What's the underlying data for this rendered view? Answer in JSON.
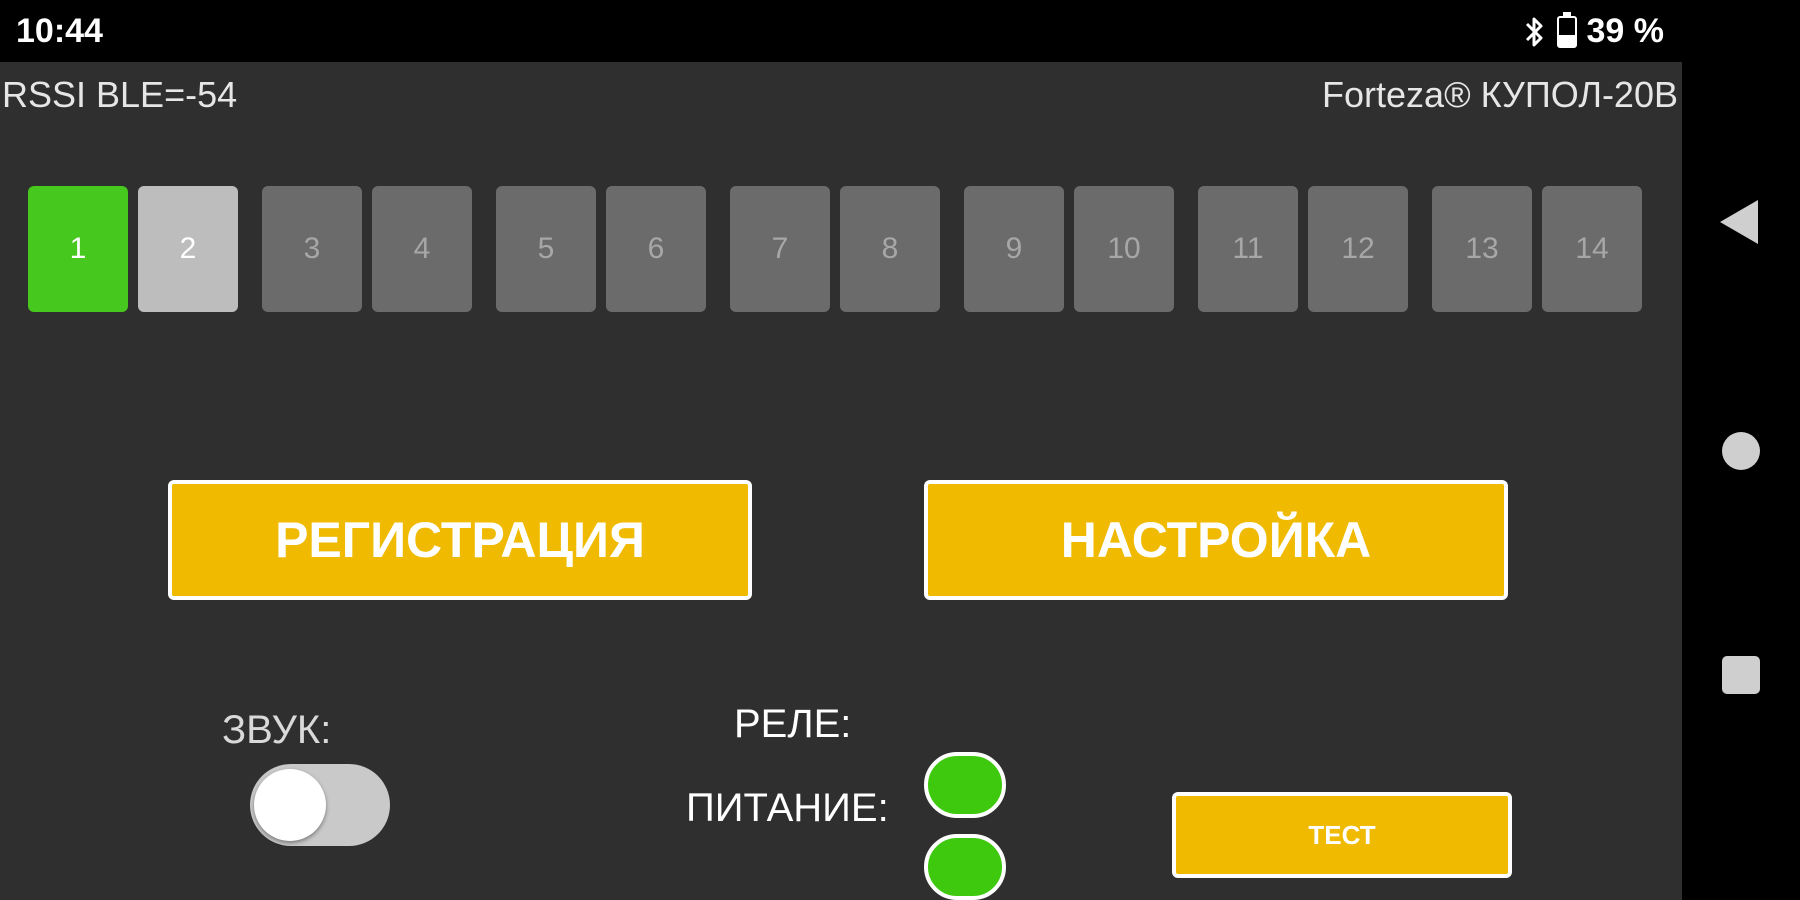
{
  "status_bar": {
    "time": "10:44",
    "battery_percent_text": "39 %",
    "battery_level": 0.39,
    "icons": [
      "bluetooth-icon",
      "battery-icon"
    ]
  },
  "header": {
    "rssi": "RSSI BLE=-54",
    "device_name": "Forteza® КУПОЛ-20B"
  },
  "zones": [
    {
      "label": "1",
      "state": "active"
    },
    {
      "label": "2",
      "state": "selected"
    },
    {
      "label": "3",
      "state": "inactive"
    },
    {
      "label": "4",
      "state": "inactive"
    },
    {
      "label": "5",
      "state": "inactive"
    },
    {
      "label": "6",
      "state": "inactive"
    },
    {
      "label": "7",
      "state": "inactive"
    },
    {
      "label": "8",
      "state": "inactive"
    },
    {
      "label": "9",
      "state": "inactive"
    },
    {
      "label": "10",
      "state": "inactive"
    },
    {
      "label": "11",
      "state": "inactive"
    },
    {
      "label": "12",
      "state": "inactive"
    },
    {
      "label": "13",
      "state": "inactive"
    },
    {
      "label": "14",
      "state": "inactive"
    }
  ],
  "buttons": {
    "registration": "РЕГИСТРАЦИЯ",
    "settings": "НАСТРОЙКА",
    "test": "ТЕСТ"
  },
  "sound": {
    "label": "ЗВУК:",
    "enabled": false
  },
  "indicators": {
    "relay_label": "РЕЛЕ:",
    "power_label": "ПИТАНИЕ:",
    "relay_on": true,
    "power_on": true
  },
  "colors": {
    "background": "#2f2f2f",
    "accent": "#efba00",
    "zone_active": "#46c81e",
    "zone_selected": "#bdbdbd",
    "zone_inactive": "#6b6b6b",
    "led_on": "#3ec90f"
  },
  "nav_bar": {
    "icons": [
      "back-icon",
      "home-icon",
      "recents-icon"
    ]
  }
}
